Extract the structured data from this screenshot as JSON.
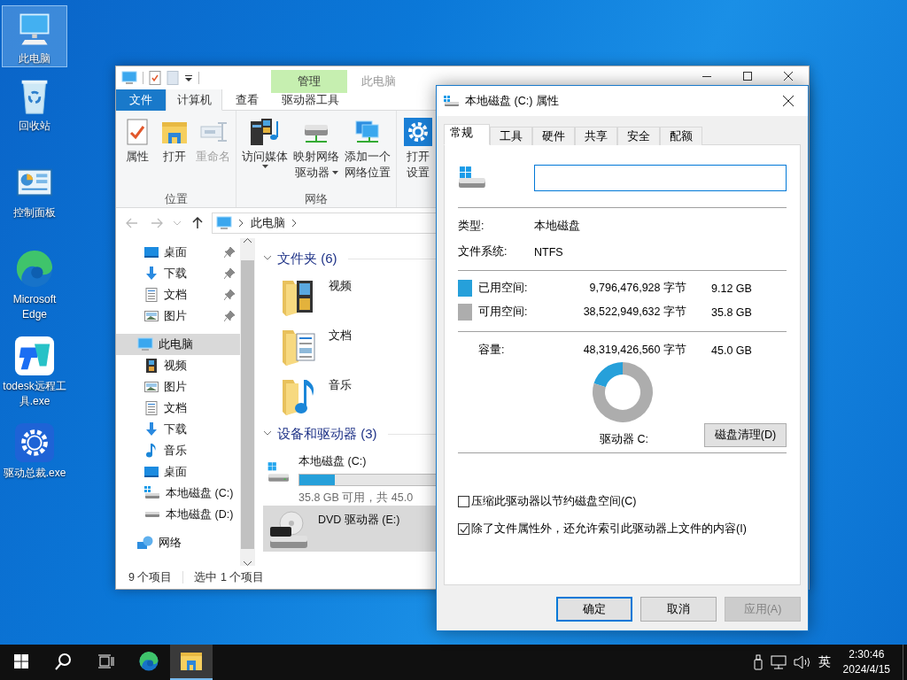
{
  "desktop_icons": [
    {
      "label": "此电脑",
      "kind": "computer",
      "selected": true
    },
    {
      "label": "回收站",
      "kind": "recycle",
      "selected": false
    },
    {
      "label": "控制面板",
      "kind": "control",
      "selected": false
    },
    {
      "label": "Microsoft Edge",
      "kind": "edge",
      "selected": false
    },
    {
      "label": "todesk远程工具.exe",
      "kind": "todesk",
      "selected": false
    },
    {
      "label": "驱动总裁.exe",
      "kind": "driver",
      "selected": false
    }
  ],
  "explorer": {
    "title": "此电脑",
    "context_tab_header": "管理",
    "ribbon_tabs": [
      {
        "label": "文件",
        "kind": "file",
        "selected": false
      },
      {
        "label": "计算机",
        "kind": "normal",
        "selected": true
      },
      {
        "label": "查看",
        "kind": "normal",
        "selected": false
      },
      {
        "label": "驱动器工具",
        "kind": "context",
        "selected": false
      }
    ],
    "ribbon_groups": [
      {
        "label": "位置",
        "buttons": [
          {
            "lines": [
              "属性"
            ],
            "kind": "properties",
            "disabled": false,
            "dropdown": false
          },
          {
            "lines": [
              "打开"
            ],
            "kind": "open",
            "disabled": false,
            "dropdown": false
          },
          {
            "lines": [
              "重命名"
            ],
            "kind": "rename",
            "disabled": true,
            "dropdown": false
          }
        ]
      },
      {
        "label": "网络",
        "buttons": [
          {
            "lines": [
              "访问媒体"
            ],
            "kind": "media",
            "disabled": false,
            "dropdown": true
          },
          {
            "lines": [
              "映射网络",
              "驱动器"
            ],
            "kind": "mapdrive",
            "disabled": false,
            "dropdown": true
          },
          {
            "lines": [
              "添加一个",
              "网络位置"
            ],
            "kind": "netloc",
            "disabled": false,
            "dropdown": false
          }
        ]
      },
      {
        "buttons": [
          {
            "lines": [
              "打开",
              "设置"
            ],
            "kind": "settings",
            "disabled": false,
            "dropdown": false
          }
        ]
      }
    ],
    "address_path": [
      "此电脑"
    ],
    "nav_items": [
      {
        "label": "桌面",
        "kind": "desktop",
        "pinned": true,
        "selected": false
      },
      {
        "label": "下载",
        "kind": "download",
        "pinned": true,
        "selected": false
      },
      {
        "label": "文档",
        "kind": "document",
        "pinned": true,
        "selected": false
      },
      {
        "label": "图片",
        "kind": "picture",
        "pinned": true,
        "selected": false
      },
      {
        "label": "此电脑",
        "kind": "computer",
        "pinned": false,
        "selected": true,
        "children": [
          {
            "label": "视频",
            "kind": "video",
            "pinned": false,
            "selected": false
          },
          {
            "label": "图片",
            "kind": "picture",
            "pinned": false,
            "selected": false
          },
          {
            "label": "文档",
            "kind": "document",
            "pinned": false,
            "selected": false
          },
          {
            "label": "下载",
            "kind": "download",
            "pinned": false,
            "selected": false
          },
          {
            "label": "音乐",
            "kind": "music",
            "pinned": false,
            "selected": false
          },
          {
            "label": "桌面",
            "kind": "desktop",
            "pinned": false,
            "selected": false
          },
          {
            "label": "本地磁盘 (C:)",
            "kind": "sysdrive",
            "pinned": false,
            "selected": false
          },
          {
            "label": "本地磁盘 (D:)",
            "kind": "drive",
            "pinned": false,
            "selected": false
          }
        ]
      },
      {
        "label": "网络",
        "kind": "network",
        "pinned": false,
        "selected": false
      }
    ],
    "groups": [
      {
        "title": "文件夹 (6)",
        "expanded": true,
        "items": [
          {
            "label": "视频",
            "kind": "video",
            "selected": false
          },
          {
            "label": "文档",
            "kind": "document",
            "selected": false
          },
          {
            "label": "音乐",
            "kind": "music",
            "selected": false
          }
        ]
      },
      {
        "title": "设备和驱动器 (3)",
        "expanded": true,
        "items": [
          {
            "label": "本地磁盘 (C:)",
            "kind": "sysdrive",
            "selected": false,
            "level": 0.2,
            "detail": "35.8 GB 可用，共 45.0"
          },
          {
            "label": "DVD 驱动器 (E:)",
            "kind": "dvd",
            "selected": true
          }
        ]
      }
    ],
    "status_bar": {
      "item_count": "9 个项目",
      "selection": "选中 1 个项目"
    }
  },
  "dialog": {
    "title": "本地磁盘 (C:) 属性",
    "tabs": [
      {
        "label": "常规",
        "selected": true
      },
      {
        "label": "工具",
        "selected": false
      },
      {
        "label": "硬件",
        "selected": false
      },
      {
        "label": "共享",
        "selected": false
      },
      {
        "label": "安全",
        "selected": false
      },
      {
        "label": "配额",
        "selected": false
      }
    ],
    "info": [
      {
        "label": "类型:",
        "value": "本地磁盘"
      },
      {
        "label": "文件系统:",
        "value": "NTFS"
      }
    ],
    "space_rows": [
      {
        "label": "已用空间:",
        "bytes": "9,796,476,928 字节",
        "size": "9.12 GB",
        "color": "#26a0da"
      },
      {
        "label": "可用空间:",
        "bytes": "38,522,949,632 字节",
        "size": "35.8 GB",
        "color": "#adadad"
      }
    ],
    "capacity": {
      "label": "容量:",
      "bytes": "48,319,426,560 字节",
      "size": "45.0 GB"
    },
    "chart_data": {
      "type": "donut",
      "values": [
        20.3,
        79.7
      ]
    },
    "drive_label": "驱动器 C:",
    "cleanup_button": "磁盘清理(D)",
    "options": [
      {
        "label": "压缩此驱动器以节约磁盘空间(C)",
        "checked": false
      },
      {
        "label": "除了文件属性外，还允许索引此驱动器上文件的内容(I)",
        "checked": true
      }
    ],
    "buttons": [
      {
        "label": "确定",
        "kind": "default",
        "disabled": false
      },
      {
        "label": "取消",
        "kind": "normal",
        "disabled": false
      },
      {
        "label": "应用(A)",
        "kind": "normal",
        "disabled": true
      }
    ]
  },
  "taskbar": {
    "apps": [
      {
        "kind": "edge",
        "active": false
      },
      {
        "kind": "explorer",
        "active": true
      }
    ],
    "input_method": "英",
    "time": "2:30:46",
    "date": "2024/4/15"
  }
}
